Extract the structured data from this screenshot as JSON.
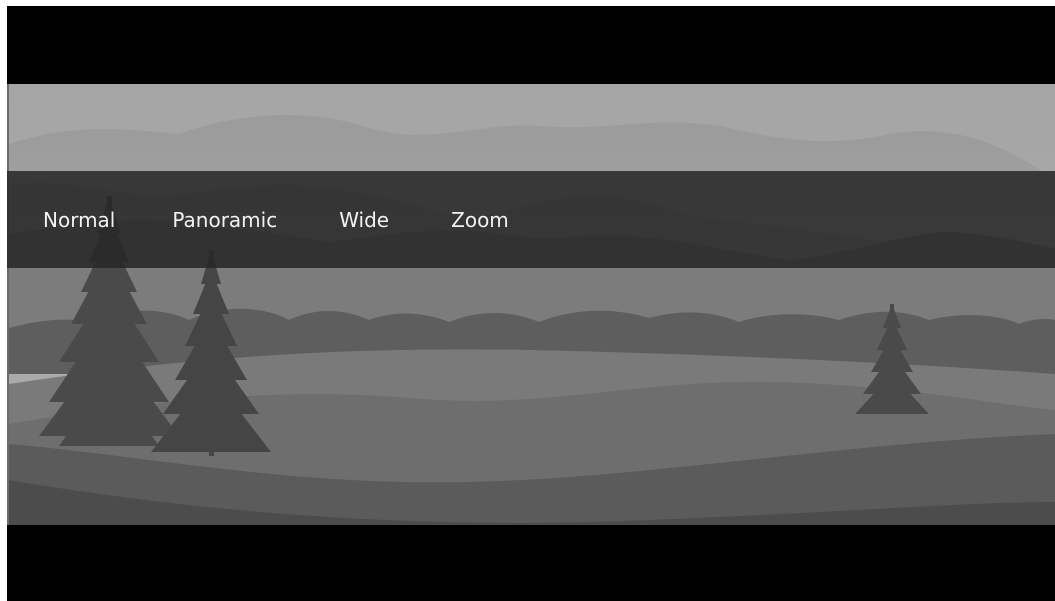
{
  "viewer": {
    "mode_bar": {
      "options": [
        {
          "label": "Normal"
        },
        {
          "label": "Panoramic"
        },
        {
          "label": "Wide"
        },
        {
          "label": "Zoom"
        }
      ]
    },
    "image": {
      "subject": "landscape-illustration-grayscale"
    }
  },
  "colors": {
    "letterbox": "#000000",
    "mode_bar": "#262626",
    "mode_text": "#f2f2f2"
  }
}
